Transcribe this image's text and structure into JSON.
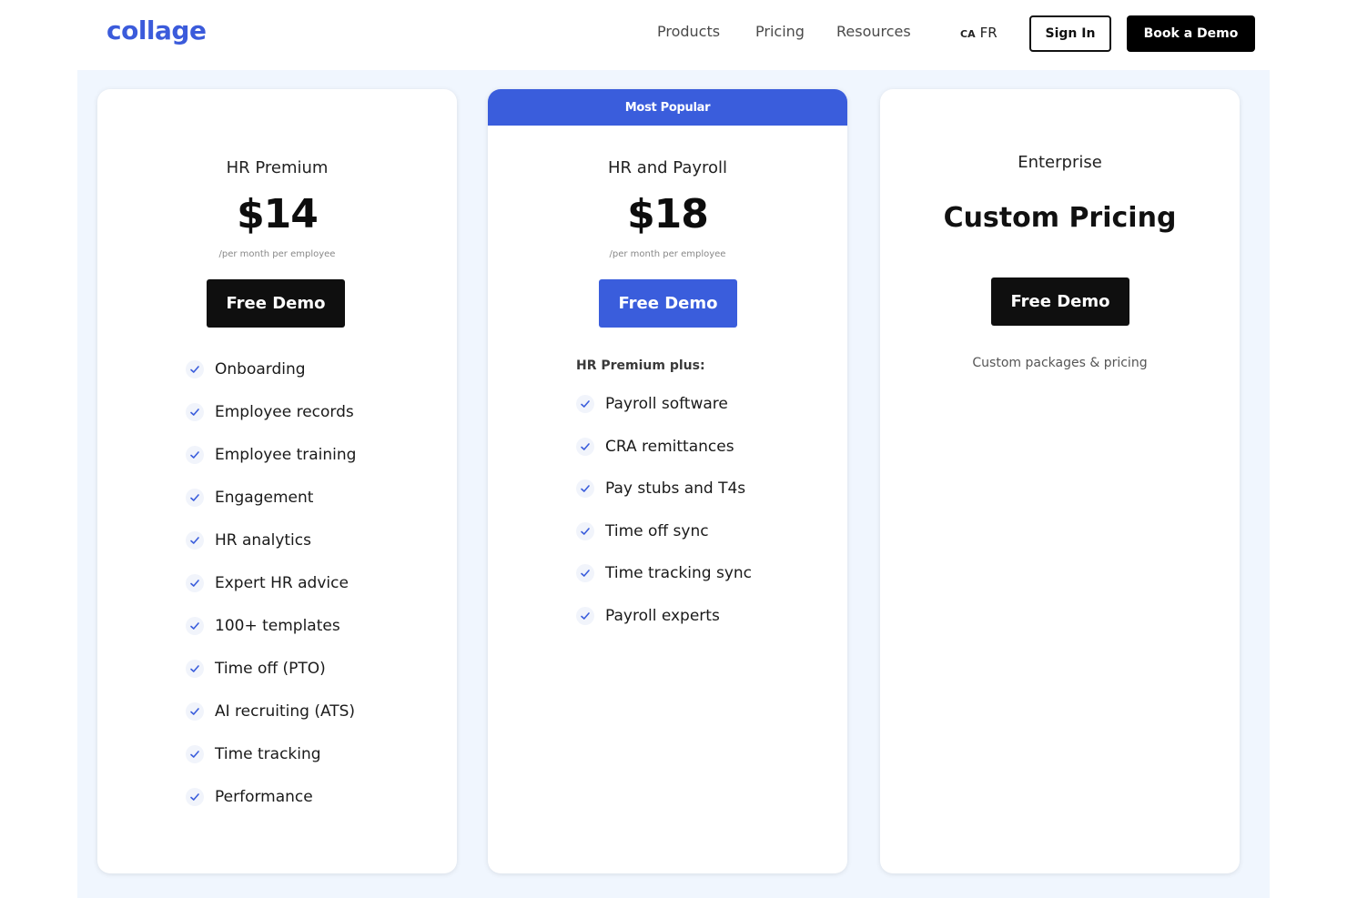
{
  "header": {
    "logo": "collage",
    "nav": [
      "Products",
      "Pricing",
      "Resources"
    ],
    "lang_flag": "CA",
    "lang_code": "FR",
    "sign_in": "Sign In",
    "book_demo": "Book a Demo"
  },
  "colors": {
    "brand": "#3a5ddc",
    "dark": "#0f0f0f",
    "section_bg": "#f0f6fe"
  },
  "plans": [
    {
      "name": "HR Premium",
      "price": "$14",
      "price_sub": "/per month per employee",
      "cta": "Free Demo",
      "features": [
        "Onboarding",
        "Employee records",
        "Employee training",
        "Engagement",
        "HR analytics",
        "Expert HR advice",
        "100+ templates",
        "Time off (PTO)",
        "AI recruiting (ATS)",
        "Time tracking",
        "Performance"
      ]
    },
    {
      "badge": "Most Popular",
      "name": "HR and Payroll",
      "price": "$18",
      "price_sub": "/per month per employee",
      "cta": "Free Demo",
      "plus_label": "HR Premium plus:",
      "features": [
        "Payroll software",
        "CRA remittances",
        "Pay stubs and T4s",
        "Time off sync",
        "Time tracking sync",
        "Payroll experts"
      ]
    },
    {
      "name": "Enterprise",
      "price": "Custom Pricing",
      "cta": "Free Demo",
      "note": "Custom packages & pricing"
    }
  ]
}
